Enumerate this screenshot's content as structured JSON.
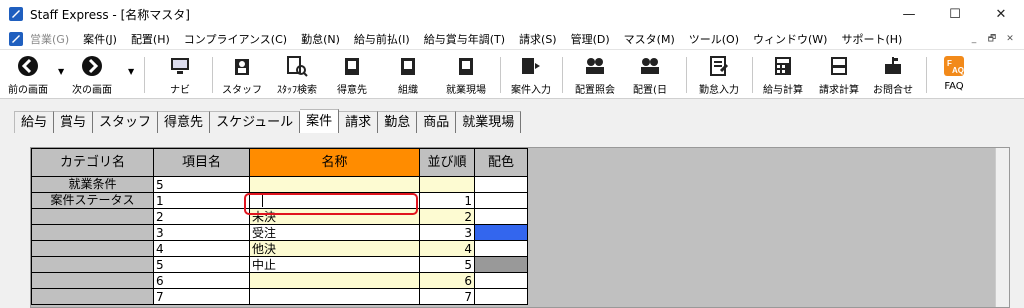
{
  "window": {
    "title": "Staff Express - [名称マスタ]",
    "minimize": "—",
    "maximize": "☐",
    "close": "✕"
  },
  "menubar": {
    "items": [
      {
        "label": "営業(G)",
        "disabled": true
      },
      {
        "label": "案件(J)"
      },
      {
        "label": "配置(H)"
      },
      {
        "label": "コンプライアンス(C)"
      },
      {
        "label": "勤怠(N)"
      },
      {
        "label": "給与前払(I)"
      },
      {
        "label": "給与賞与年調(T)"
      },
      {
        "label": "請求(S)"
      },
      {
        "label": "管理(D)"
      },
      {
        "label": "マスタ(M)"
      },
      {
        "label": "ツール(O)"
      },
      {
        "label": "ウィンドウ(W)"
      },
      {
        "label": "サポート(H)"
      }
    ],
    "mdi": [
      "_",
      "🗗",
      "✕"
    ]
  },
  "toolbar": {
    "back": "前の画面",
    "next": "次の画面",
    "navi": "ナビ",
    "staff": "スタッフ",
    "staff_search": "ｽﾀｯﾌ検索",
    "customer": "得意先",
    "org": "組織",
    "site": "就業現場",
    "job_entry": "案件入力",
    "assign_view": "配置照会",
    "assign_day": "配置(日",
    "attendance": "勤怠入力",
    "payroll": "給与計算",
    "billing": "請求計算",
    "inquiry": "お問合せ",
    "faq": "FAQ"
  },
  "tabs": [
    {
      "label": "給与"
    },
    {
      "label": "賞与"
    },
    {
      "label": "スタッフ"
    },
    {
      "label": "得意先"
    },
    {
      "label": "スケジュール"
    },
    {
      "label": "案件",
      "active": true
    },
    {
      "label": "請求"
    },
    {
      "label": "勤怠"
    },
    {
      "label": "商品"
    },
    {
      "label": "就業現場"
    }
  ],
  "grid": {
    "headers": {
      "category": "カテゴリ名",
      "item": "項目名",
      "name": "名称",
      "order": "並び順",
      "color": "配色"
    },
    "categories": {
      "work_conditions": "就業条件",
      "job_status": "案件ステータス"
    },
    "rows": [
      {
        "item": "5",
        "name": "",
        "order": "",
        "color": "",
        "cat": "work_conditions"
      },
      {
        "item": "1",
        "name": "",
        "order": "1",
        "color": "",
        "cat": "job_status",
        "editing": true
      },
      {
        "item": "2",
        "name": "未決",
        "order": "2",
        "color": ""
      },
      {
        "item": "3",
        "name": "受注",
        "order": "3",
        "color": "#3366ee"
      },
      {
        "item": "4",
        "name": "他決",
        "order": "4",
        "color": ""
      },
      {
        "item": "5",
        "name": "中止",
        "order": "5",
        "color": "#999999"
      },
      {
        "item": "6",
        "name": "",
        "order": "6",
        "color": ""
      },
      {
        "item": "7",
        "name": "",
        "order": "7",
        "color": ""
      }
    ]
  },
  "colors": {
    "header_highlight": "#ff8c00",
    "alt_row": "#fdfbd2",
    "edit_ring": "#e0141e"
  }
}
